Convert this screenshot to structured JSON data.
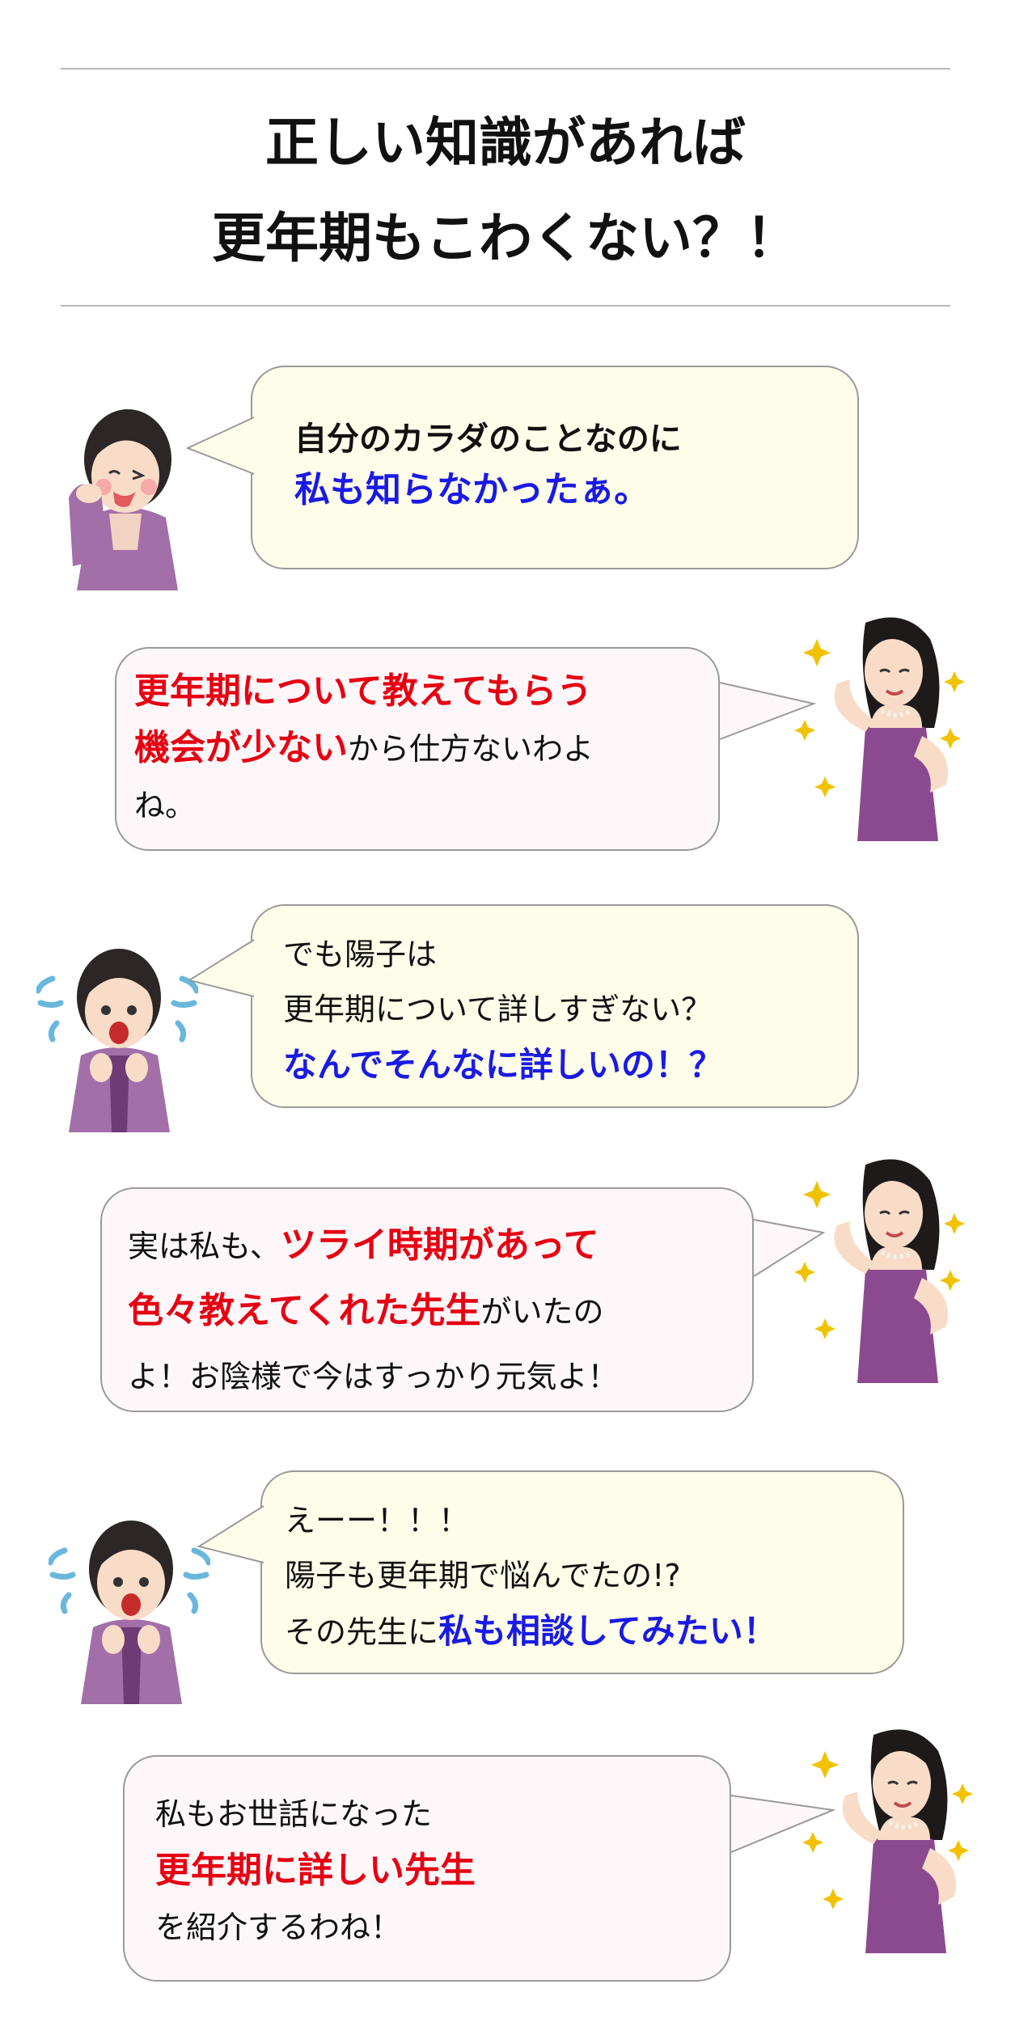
{
  "title": {
    "line1": "正しい知識があれば",
    "line2": "更年期もこわくない？！"
  },
  "colors": {
    "highlight_red": "#e60012",
    "highlight_blue": "#1a1ae6",
    "bubble_yellow": "#fdfde9",
    "bubble_pink": "#fdf7f9",
    "dress": "#8b4a8f"
  },
  "dialogue": [
    {
      "speaker_icon": "woman-hand-on-neck-icon",
      "line1": "自分のカラダのことなのに",
      "line2_blue": "私も知らなかったぁ。"
    },
    {
      "speaker_icon": "glamorous-woman-icon",
      "line1_red": "更年期について教えてもらう",
      "line2_red": "機会が少ない",
      "line2_rest": "から仕方ないわよ",
      "line3": "ね。"
    },
    {
      "speaker_icon": "surprised-woman-icon",
      "line1": "でも陽子は",
      "line2": "更年期について詳しすぎない？",
      "line3_blue": "なんでそんなに詳しいの！？"
    },
    {
      "speaker_icon": "glamorous-woman-icon",
      "line1_start": "実は私も、",
      "line1_red": "ツライ時期があって",
      "line2_red": "色々教えてくれた先生",
      "line2_rest": "がいたの",
      "line3": "よ！お陰様で今はすっかり元気よ！"
    },
    {
      "speaker_icon": "surprised-woman-icon",
      "line1": "えーー！！！",
      "line2": "陽子も更年期で悩んでたの!?",
      "line3_start": "その先生に",
      "line3_blue": "私も相談してみたい！"
    },
    {
      "speaker_icon": "glamorous-woman-icon",
      "line1": "私もお世話になった",
      "line2_red": "更年期に詳しい先生",
      "line3": "を紹介するわね！"
    }
  ]
}
